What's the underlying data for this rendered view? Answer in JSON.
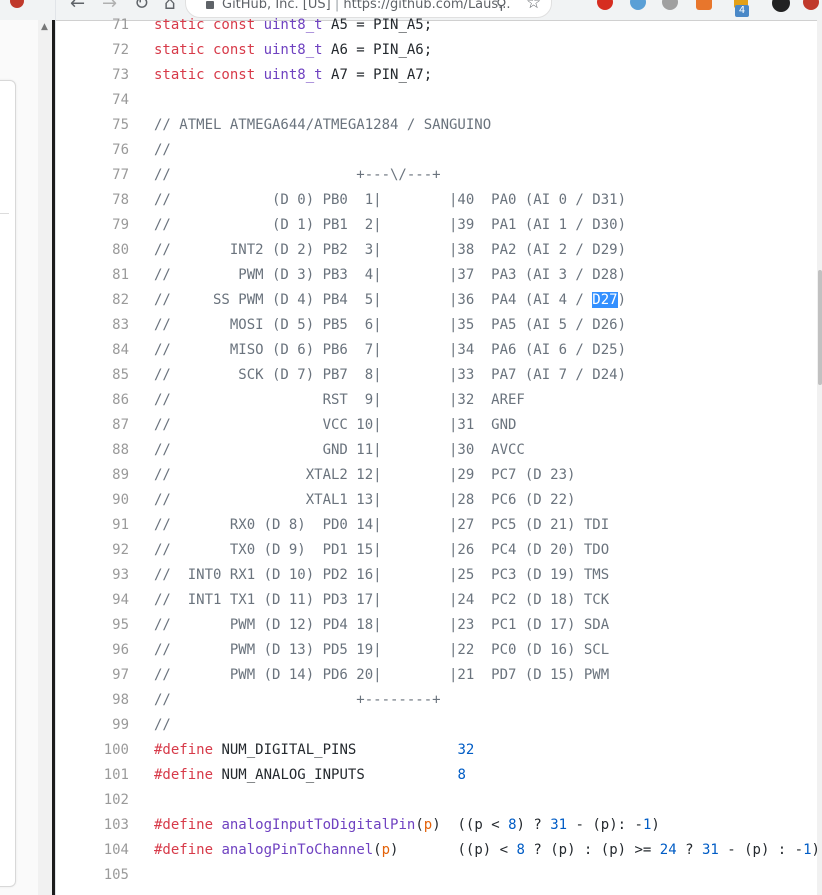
{
  "browser": {
    "nav_icons": [
      "back-arrow-icon",
      "forward-arrow-icon",
      "reload-icon",
      "home-icon"
    ],
    "tab_title": "GitHub, Inc. [US]",
    "url": "https://github.com/Laus...",
    "extension_badge": "4"
  },
  "code_lines": [
    {
      "n": "71",
      "segs": [
        {
          "t": "static const ",
          "c": "kw"
        },
        {
          "t": "uint8_t",
          "c": "ty"
        },
        {
          "t": " A5 = PIN_A5;",
          "c": ""
        }
      ]
    },
    {
      "n": "72",
      "segs": [
        {
          "t": "static const ",
          "c": "kw"
        },
        {
          "t": "uint8_t",
          "c": "ty"
        },
        {
          "t": " A6 = PIN_A6;",
          "c": ""
        }
      ]
    },
    {
      "n": "73",
      "segs": [
        {
          "t": "static const ",
          "c": "kw"
        },
        {
          "t": "uint8_t",
          "c": "ty"
        },
        {
          "t": " A7 = PIN_A7;",
          "c": ""
        }
      ]
    },
    {
      "n": "74",
      "segs": []
    },
    {
      "n": "75",
      "segs": [
        {
          "t": "// ATMEL ATMEGA644/ATMEGA1284 / SANGUINO",
          "c": "cm"
        }
      ]
    },
    {
      "n": "76",
      "segs": [
        {
          "t": "//",
          "c": "cm"
        }
      ]
    },
    {
      "n": "77",
      "segs": [
        {
          "t": "//                      +---\\/---+",
          "c": "cm"
        }
      ]
    },
    {
      "n": "78",
      "segs": [
        {
          "t": "//            (D 0) PB0  1|        |40  PA0 (AI 0 / D31)",
          "c": "cm"
        }
      ]
    },
    {
      "n": "79",
      "segs": [
        {
          "t": "//            (D 1) PB1  2|        |39  PA1 (AI 1 / D30)",
          "c": "cm"
        }
      ]
    },
    {
      "n": "80",
      "segs": [
        {
          "t": "//       INT2 (D 2) PB2  3|        |38  PA2 (AI 2 / D29)",
          "c": "cm"
        }
      ]
    },
    {
      "n": "81",
      "segs": [
        {
          "t": "//        PWM (D 3) PB3  4|        |37  PA3 (AI 3 / D28)",
          "c": "cm"
        }
      ]
    },
    {
      "n": "82",
      "segs": [
        {
          "t": "//     SS PWM (D 4) PB4  5|        |36  PA4 (AI 4 / ",
          "c": "cm"
        },
        {
          "t": "D27",
          "c": "sel"
        },
        {
          "t": ")",
          "c": "cm"
        }
      ]
    },
    {
      "n": "83",
      "segs": [
        {
          "t": "//       MOSI (D 5) PB5  6|        |35  PA5 (AI 5 / D26)",
          "c": "cm"
        }
      ]
    },
    {
      "n": "84",
      "segs": [
        {
          "t": "//       MISO (D 6) PB6  7|        |34  PA6 (AI 6 / D25)",
          "c": "cm"
        }
      ]
    },
    {
      "n": "85",
      "segs": [
        {
          "t": "//        SCK (D 7) PB7  8|        |33  PA7 (AI 7 / D24)",
          "c": "cm"
        }
      ]
    },
    {
      "n": "86",
      "segs": [
        {
          "t": "//                  RST  9|        |32  AREF",
          "c": "cm"
        }
      ]
    },
    {
      "n": "87",
      "segs": [
        {
          "t": "//                  VCC 10|        |31  GND",
          "c": "cm"
        }
      ]
    },
    {
      "n": "88",
      "segs": [
        {
          "t": "//                  GND 11|        |30  AVCC",
          "c": "cm"
        }
      ]
    },
    {
      "n": "89",
      "segs": [
        {
          "t": "//                XTAL2 12|        |29  PC7 (D 23)",
          "c": "cm"
        }
      ]
    },
    {
      "n": "90",
      "segs": [
        {
          "t": "//                XTAL1 13|        |28  PC6 (D 22)",
          "c": "cm"
        }
      ]
    },
    {
      "n": "91",
      "segs": [
        {
          "t": "//       RX0 (D 8)  PD0 14|        |27  PC5 (D 21) TDI",
          "c": "cm"
        }
      ]
    },
    {
      "n": "92",
      "segs": [
        {
          "t": "//       TX0 (D 9)  PD1 15|        |26  PC4 (D 20) TDO",
          "c": "cm"
        }
      ]
    },
    {
      "n": "93",
      "segs": [
        {
          "t": "//  INT0 RX1 (D 10) PD2 16|        |25  PC3 (D 19) TMS",
          "c": "cm"
        }
      ]
    },
    {
      "n": "94",
      "segs": [
        {
          "t": "//  INT1 TX1 (D 11) PD3 17|        |24  PC2 (D 18) TCK",
          "c": "cm"
        }
      ]
    },
    {
      "n": "95",
      "segs": [
        {
          "t": "//       PWM (D 12) PD4 18|        |23  PC1 (D 17) SDA",
          "c": "cm"
        }
      ]
    },
    {
      "n": "96",
      "segs": [
        {
          "t": "//       PWM (D 13) PD5 19|        |22  PC0 (D 16) SCL",
          "c": "cm"
        }
      ]
    },
    {
      "n": "97",
      "segs": [
        {
          "t": "//       PWM (D 14) PD6 20|        |21  PD7 (D 15) PWM",
          "c": "cm"
        }
      ]
    },
    {
      "n": "98",
      "segs": [
        {
          "t": "//                      +--------+",
          "c": "cm"
        }
      ]
    },
    {
      "n": "99",
      "segs": [
        {
          "t": "//",
          "c": "cm"
        }
      ]
    },
    {
      "n": "100",
      "segs": [
        {
          "t": "#define",
          "c": "kw"
        },
        {
          "t": " ",
          "c": ""
        },
        {
          "t": "NUM_DIGITAL_PINS",
          "c": ""
        },
        {
          "t": "            ",
          "c": ""
        },
        {
          "t": "32",
          "c": "num"
        }
      ]
    },
    {
      "n": "101",
      "segs": [
        {
          "t": "#define",
          "c": "kw"
        },
        {
          "t": " ",
          "c": ""
        },
        {
          "t": "NUM_ANALOG_INPUTS",
          "c": ""
        },
        {
          "t": "           ",
          "c": ""
        },
        {
          "t": "8",
          "c": "num"
        }
      ]
    },
    {
      "n": "102",
      "segs": []
    },
    {
      "n": "103",
      "segs": [
        {
          "t": "#define",
          "c": "kw"
        },
        {
          "t": " ",
          "c": ""
        },
        {
          "t": "analogInputToDigitalPin",
          "c": "fn"
        },
        {
          "t": "(",
          "c": ""
        },
        {
          "t": "p",
          "c": "par"
        },
        {
          "t": ")  ((p < ",
          "c": ""
        },
        {
          "t": "8",
          "c": "num"
        },
        {
          "t": ") ? ",
          "c": ""
        },
        {
          "t": "31",
          "c": "num"
        },
        {
          "t": " - (p): -",
          "c": ""
        },
        {
          "t": "1",
          "c": "num"
        },
        {
          "t": ")",
          "c": ""
        }
      ]
    },
    {
      "n": "104",
      "segs": [
        {
          "t": "#define",
          "c": "kw"
        },
        {
          "t": " ",
          "c": ""
        },
        {
          "t": "analogPinToChannel",
          "c": "fn"
        },
        {
          "t": "(",
          "c": ""
        },
        {
          "t": "p",
          "c": "par"
        },
        {
          "t": ")       ((p) < ",
          "c": ""
        },
        {
          "t": "8",
          "c": "num"
        },
        {
          "t": " ? (p) : (p) >= ",
          "c": ""
        },
        {
          "t": "24",
          "c": "num"
        },
        {
          "t": " ? ",
          "c": ""
        },
        {
          "t": "31",
          "c": "num"
        },
        {
          "t": " - (p) : -",
          "c": ""
        },
        {
          "t": "1",
          "c": "num"
        },
        {
          "t": ")",
          "c": ""
        }
      ]
    },
    {
      "n": "105",
      "segs": []
    }
  ]
}
